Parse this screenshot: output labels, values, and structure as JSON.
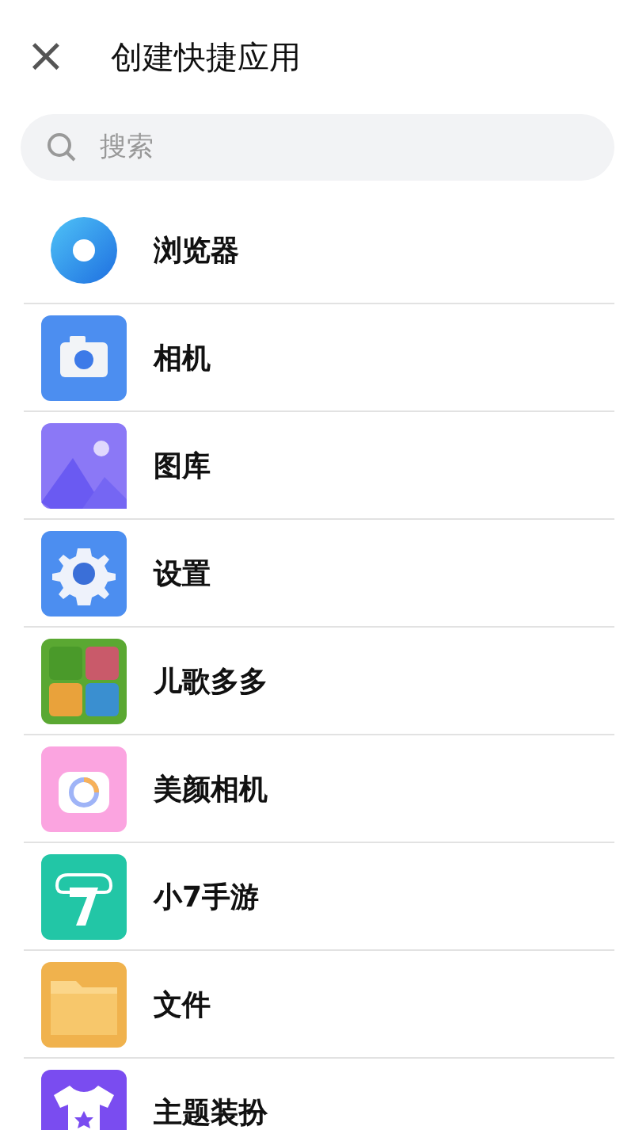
{
  "header": {
    "close": "×",
    "title": "创建快捷应用"
  },
  "search": {
    "placeholder": "搜索"
  },
  "apps": [
    {
      "name": "浏览器",
      "kind": "browser"
    },
    {
      "name": "相机",
      "kind": "camera"
    },
    {
      "name": "图库",
      "kind": "gallery"
    },
    {
      "name": "设置",
      "kind": "settings"
    },
    {
      "name": "儿歌多多",
      "kind": "kids"
    },
    {
      "name": "美颜相机",
      "kind": "beauty"
    },
    {
      "name": "小7手游",
      "kind": "game"
    },
    {
      "name": "文件",
      "kind": "files"
    },
    {
      "name": "主题装扮",
      "kind": "theme"
    }
  ]
}
